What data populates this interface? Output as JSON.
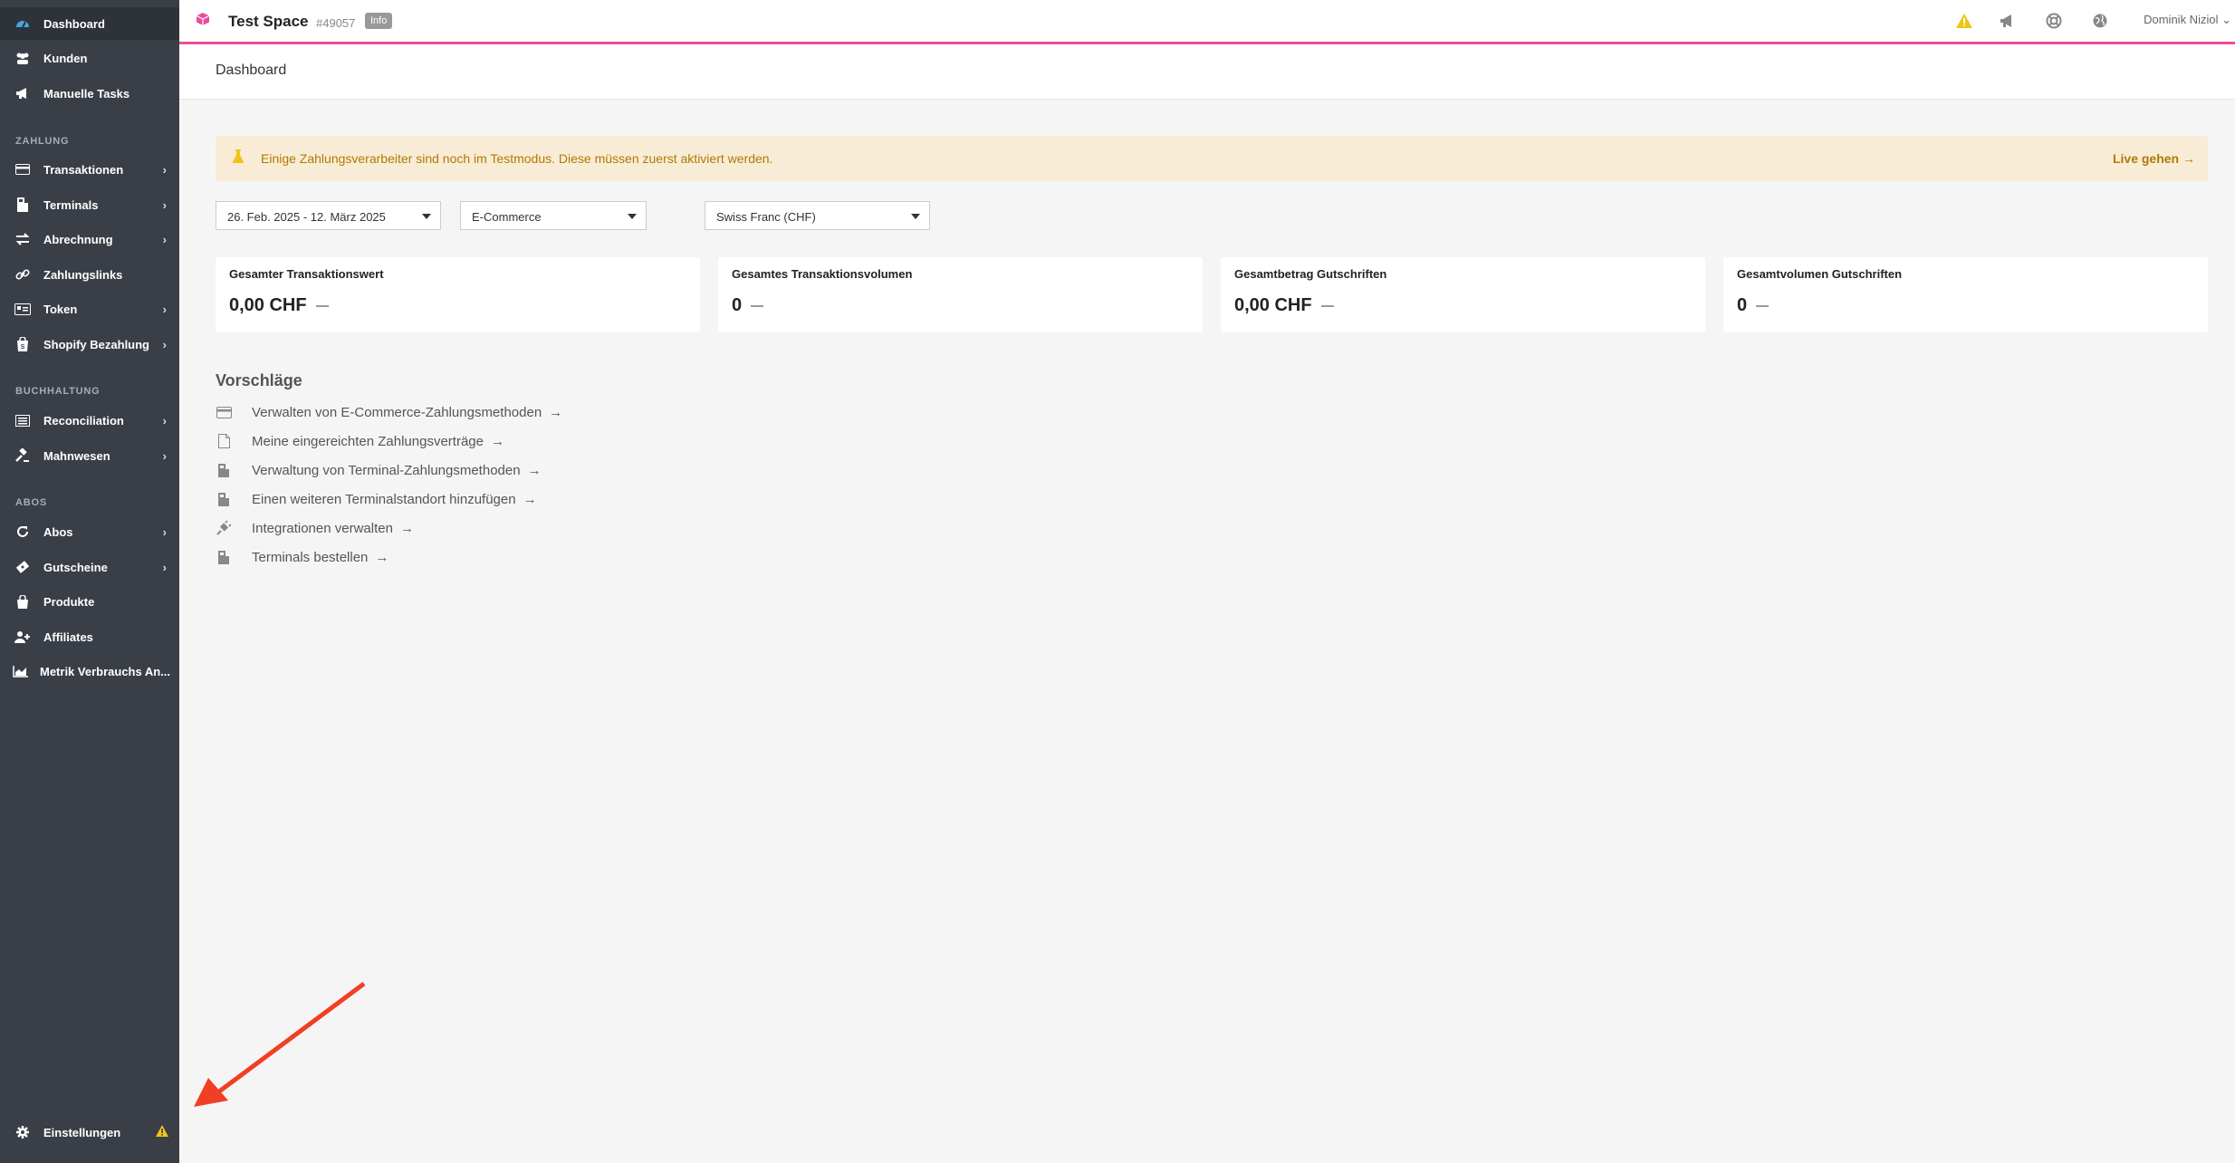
{
  "sidebar": {
    "items": [
      {
        "label": "Dashboard",
        "icon": "tachometer-icon",
        "active": true
      },
      {
        "label": "Kunden",
        "icon": "users-icon"
      },
      {
        "label": "Manuelle Tasks",
        "icon": "megaphone-icon"
      },
      {
        "label": "Transaktionen",
        "icon": "credit-card-icon",
        "chevron": true
      },
      {
        "label": "Terminals",
        "icon": "terminal-icon",
        "chevron": true
      },
      {
        "label": "Abrechnung",
        "icon": "exchange-icon",
        "chevron": true
      },
      {
        "label": "Zahlungslinks",
        "icon": "link-icon"
      },
      {
        "label": "Token",
        "icon": "id-card-icon",
        "chevron": true
      },
      {
        "label": "Shopify Bezahlung",
        "icon": "shopify-bag-icon",
        "chevron": true
      },
      {
        "label": "Reconciliation",
        "icon": "ledger-icon",
        "chevron": true
      },
      {
        "label": "Mahnwesen",
        "icon": "gavel-icon",
        "chevron": true
      },
      {
        "label": "Abos",
        "icon": "refresh-icon",
        "chevron": true
      },
      {
        "label": "Gutscheine",
        "icon": "ticket-icon",
        "chevron": true
      },
      {
        "label": "Produkte",
        "icon": "shopping-bag-icon"
      },
      {
        "label": "Affiliates",
        "icon": "user-plus-icon"
      },
      {
        "label": "Metrik Verbrauchs An...",
        "icon": "area-chart-icon"
      }
    ],
    "sections": {
      "zahlung": "ZAHLUNG",
      "buchhaltung": "BUCHHALTUNG",
      "abos": "ABOS"
    },
    "settings_label": "Einstellungen"
  },
  "topbar": {
    "space_title": "Test Space",
    "space_id": "#49057",
    "info_badge": "Info",
    "user_name": "Dominik Niziol",
    "accent_color": "#ec4c9a"
  },
  "header": {
    "title": "Dashboard"
  },
  "alert": {
    "text": "Einige Zahlungsverarbeiter sind noch im Testmodus. Diese müssen zuerst aktiviert werden.",
    "link": "Live gehen"
  },
  "filters": {
    "date_range": "26. Feb. 2025 - 12. März 2025",
    "channel": "E-Commerce",
    "currency": "Swiss Franc (CHF)"
  },
  "cards": [
    {
      "label": "Gesamter Transaktionswert",
      "value": "0,00 CHF"
    },
    {
      "label": "Gesamtes Transaktionsvolumen",
      "value": "0"
    },
    {
      "label": "Gesamtbetrag Gutschriften",
      "value": "0,00 CHF"
    },
    {
      "label": "Gesamtvolumen Gutschriften",
      "value": "0"
    }
  ],
  "suggestions": {
    "title": "Vorschläge",
    "items": [
      "Verwalten von E-Commerce-Zahlungsmethoden",
      "Meine eingereichten Zahlungsverträge",
      "Verwaltung von Terminal-Zahlungsmethoden",
      "Einen weiteren Terminalstandort hinzufügen",
      "Integrationen verwalten",
      "Terminals bestellen"
    ]
  }
}
